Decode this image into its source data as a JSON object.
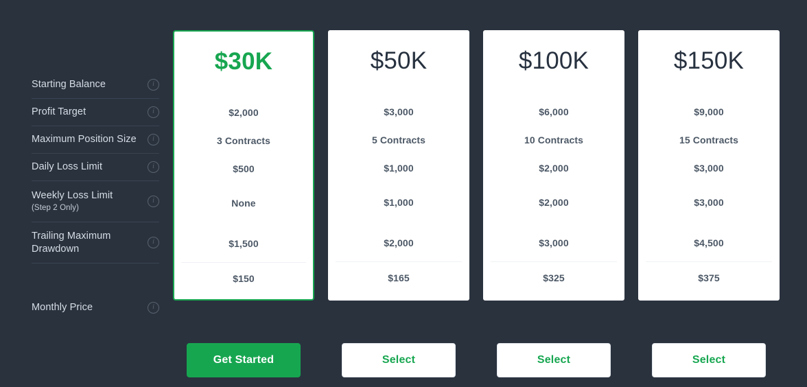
{
  "theme": {
    "background": "#2a323e",
    "accent_green": "#17a650",
    "card_background": "#ffffff",
    "label_color": "#d6dde5",
    "value_color": "#4c5866",
    "divider_color": "#3a4452"
  },
  "features": [
    {
      "label": "Starting Balance",
      "sublabel": "",
      "icon": "info-icon"
    },
    {
      "label": "Profit Target",
      "sublabel": "",
      "icon": "info-icon"
    },
    {
      "label": "Maximum Position Size",
      "sublabel": "",
      "icon": "info-icon"
    },
    {
      "label": "Daily Loss Limit",
      "sublabel": "",
      "icon": "info-icon"
    },
    {
      "label": "Weekly Loss Limit",
      "sublabel": "(Step 2 Only)",
      "icon": "info-icon"
    },
    {
      "label": "Trailing Maximum Drawdown",
      "sublabel": "",
      "icon": "info-icon"
    },
    {
      "label": "Monthly Price",
      "sublabel": "",
      "icon": "info-icon"
    }
  ],
  "plans": [
    {
      "title": "$30K",
      "featured": true,
      "values": [
        "$2,000",
        "3 Contracts",
        "$500",
        "None",
        "$1,500",
        "$150"
      ],
      "button_label": "Get Started",
      "button_style": "primary"
    },
    {
      "title": "$50K",
      "featured": false,
      "values": [
        "$3,000",
        "5 Contracts",
        "$1,000",
        "$1,000",
        "$2,000",
        "$165"
      ],
      "button_label": "Select",
      "button_style": "outline"
    },
    {
      "title": "$100K",
      "featured": false,
      "values": [
        "$6,000",
        "10 Contracts",
        "$2,000",
        "$2,000",
        "$3,000",
        "$325"
      ],
      "button_label": "Select",
      "button_style": "outline"
    },
    {
      "title": "$150K",
      "featured": false,
      "values": [
        "$9,000",
        "15 Contracts",
        "$3,000",
        "$3,000",
        "$4,500",
        "$375"
      ],
      "button_label": "Select",
      "button_style": "outline"
    }
  ]
}
